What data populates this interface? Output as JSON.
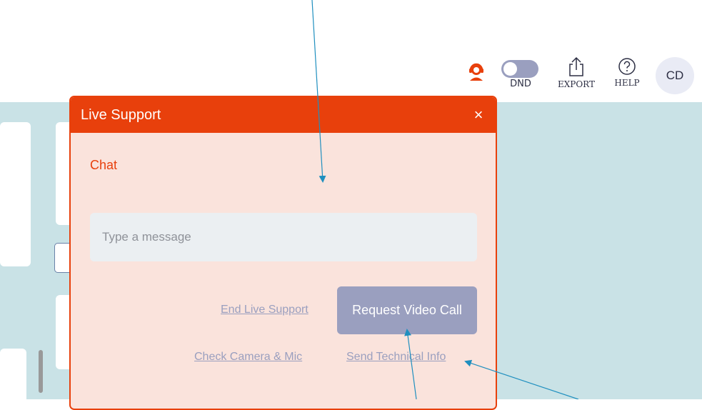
{
  "header": {
    "dnd_label": "DND",
    "export_label": "EXPORT",
    "help_label": "HELP",
    "avatar_initials": "CD",
    "icons": {
      "agent": "support-agent-icon",
      "export": "share-export-icon",
      "help": "question-circle-icon"
    }
  },
  "live_support": {
    "title": "Live Support",
    "close_label": "×",
    "chat_label": "Chat",
    "message_placeholder": "Type a message",
    "message_value": "",
    "end_label": "End Live Support",
    "video_call_label": "Request Video Call",
    "check_label": "Check Camera & Mic",
    "send_info_label": "Send Technical Info"
  },
  "colors": {
    "accent": "#e8400c",
    "panel_bg": "#fae3dc",
    "muted_button": "#9a9fbf",
    "workspace_bg": "#c9e2e6",
    "annotation_arrow": "#1f8fbf"
  }
}
